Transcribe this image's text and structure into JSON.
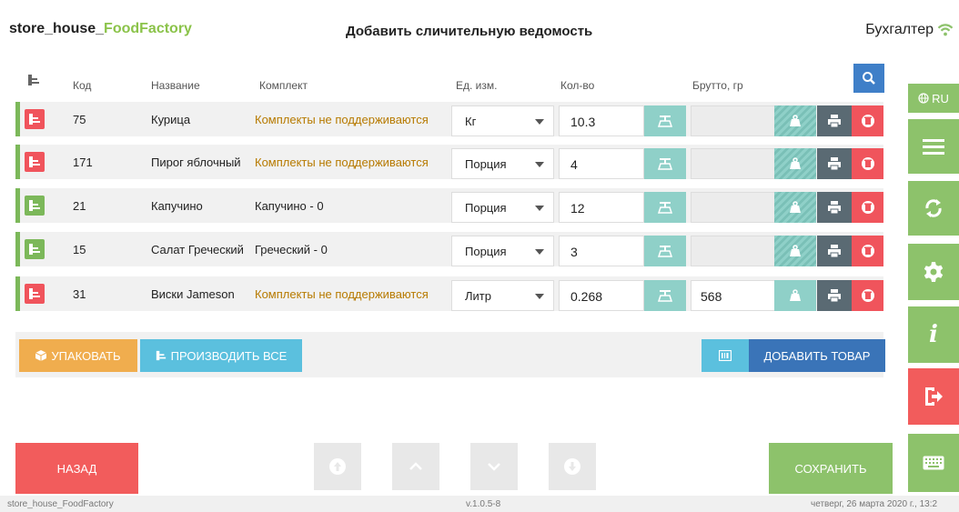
{
  "header": {
    "app_name_main": "store_house_",
    "app_name_accent": "FoodFactory",
    "page_title": "Добавить сличительную ведомость",
    "user": "Бухгалтер"
  },
  "columns": {
    "code": "Код",
    "name": "Название",
    "kit": "Комплект",
    "unit": "Ед. изм.",
    "qty": "Кол-во",
    "brutto": "Брутто, гр"
  },
  "rows": [
    {
      "code": "75",
      "name": "Курица",
      "kit": "Комплекты не поддерживаются",
      "unit": "Кг",
      "qty": "10.3",
      "brutto": ""
    },
    {
      "code": "171",
      "name": "Пирог яблочный",
      "kit": "Комплекты не поддерживаются",
      "unit": "Порция",
      "qty": "4",
      "brutto": ""
    },
    {
      "code": "21",
      "name": "Капучино",
      "kit": "Капучино - 0",
      "unit": "Порция",
      "qty": "12",
      "brutto": ""
    },
    {
      "code": "15",
      "name": "Салат Греческий",
      "kit": "Греческий - 0",
      "unit": "Порция",
      "qty": "3",
      "brutto": ""
    },
    {
      "code": "31",
      "name": "Виски Jameson",
      "kit": "Комплекты не поддерживаются",
      "unit": "Литр",
      "qty": "0.268",
      "brutto": "568"
    }
  ],
  "actions": {
    "pack": "УПАКОВАТЬ",
    "produce_all": "ПРОИЗВОДИТЬ ВСЕ",
    "add_item": "ДОБАВИТЬ ТОВАР"
  },
  "bottom": {
    "back": "НАЗАД",
    "save": "СОХРАНИТЬ"
  },
  "sidebar": {
    "lang": "RU",
    "info": "i"
  },
  "footer": {
    "left": "store_house_FoodFactory",
    "version": "v.1.0.5-8",
    "datetime": "четверг, 26 марта 2020 г., 13:2"
  },
  "colors": {
    "accent_green": "#8dc26b",
    "danger_red": "#f25c5c",
    "primary_blue": "#3a74b8",
    "info_blue": "#5bc0de",
    "warning_orange": "#f0ad4e",
    "teal": "#8fd0c8"
  }
}
